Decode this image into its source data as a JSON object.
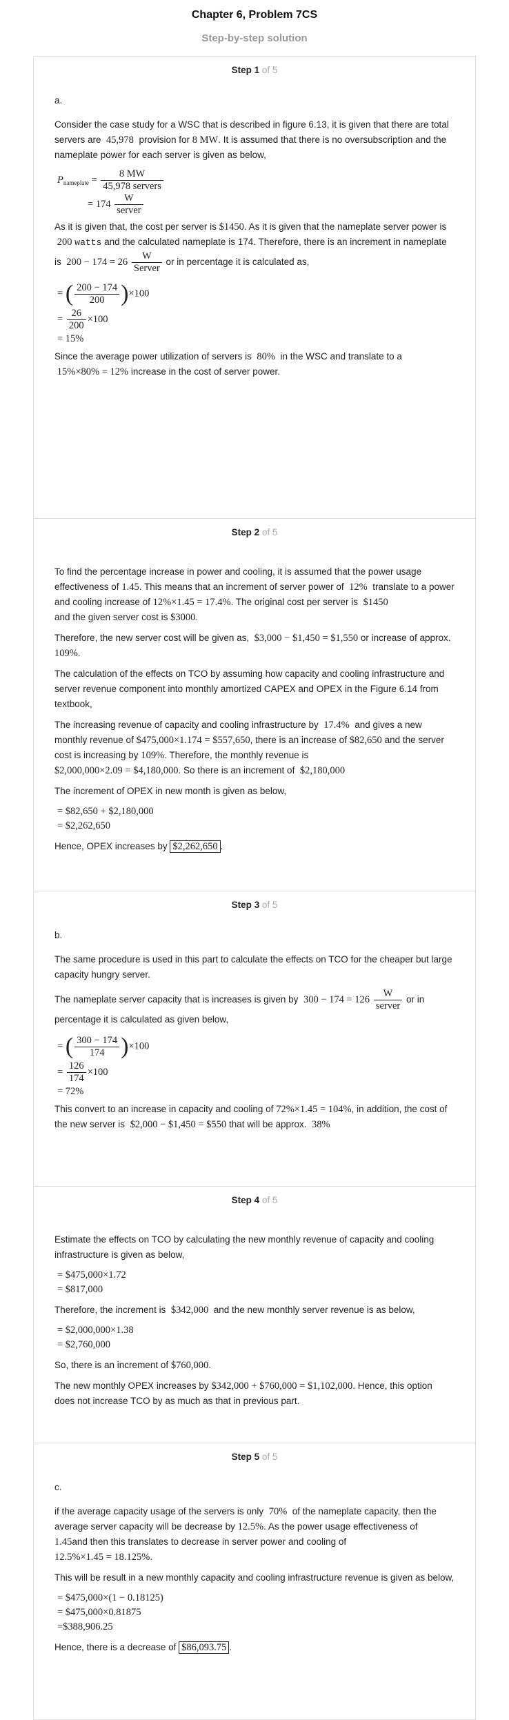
{
  "header": {
    "title": "Chapter 6, Problem 7CS",
    "subtitle": "Step-by-step solution"
  },
  "steps": [
    {
      "label": "Step 1",
      "of": "of 5",
      "part": "a.",
      "p1a": "Consider the case study for a WSC that is described in figure 6.13, it is given that there are total servers are",
      "p1_servers": "45,978",
      "p1b": "provision for",
      "p1_mw": "8 MW",
      "p1c": ". It is assumed that there is no oversubscription and the nameplate power for each server is given as below,",
      "eq1_lhs": "P",
      "eq1_sub": "nameplate",
      "eq1_num": "8 MW",
      "eq1_den": "45,978 servers",
      "eq1_res": "174",
      "eq1_unit_num": "W",
      "eq1_unit_den": "server",
      "p2a": "As it is given that, the cost per server is",
      "p2_cost": "$1450",
      "p2b": ". As it is given that the nameplate server power is",
      "p2_200": "200",
      "p2_watts": "watts",
      "p2c": "and the calculated nameplate is 174. Therefore, there is an increment in nameplate is",
      "p2_expr": "200 − 174 = 26",
      "p2_unit_num": "W",
      "p2_unit_den": "Server",
      "p2d": "or in percentage it is calculated as,",
      "eq2_num": "200 − 174",
      "eq2_den": "200",
      "eq2_tail": "×100",
      "eq2b_num": "26",
      "eq2b_den": "200",
      "eq2b_tail": "×100",
      "eq2c": "= 15%",
      "p3a": "Since the average power utilization of servers is",
      "p3_pct": "80%",
      "p3b": "in the WSC and translate to a",
      "p3_expr": "15%×80% = 12%",
      "p3c": "increase in the cost of server power."
    },
    {
      "label": "Step 2",
      "of": "of 5",
      "p1a": "To find the percentage increase in power and cooling, it is assumed that the power usage effectiveness of",
      "p1_pue": "1.45",
      "p1b": ". This means that an increment of server power of",
      "p1_12": "12%",
      "p1c": "translate to a power and cooling increase of",
      "p1_expr": "12%×1.45 = 17.4%",
      "p1d": ". The original cost per server is",
      "p1_1450": "$1450",
      "p1e": "and the given server cost is",
      "p1_3000": "$3000",
      "p1f": ".",
      "p2a": "Therefore, the new server cost will be given as,",
      "p2_expr": "$3,000 − $1,450 = $1,550",
      "p2b": "or increase of approx.",
      "p2_pct": "109%",
      "p2c": ".",
      "p3": "The calculation of the effects on TCO by assuming how capacity and cooling infrastructure and server revenue component into monthly amortized CAPEX and OPEX in the Figure 6.14 from textbook,",
      "p4a": "The increasing revenue of capacity and cooling infrastructure by",
      "p4_pct": "17.4%",
      "p4b": "and gives a new monthly revenue of",
      "p4_expr1": "$475,000×1.174 = $557,650",
      "p4c": ", there is an increase of",
      "p4_inc": "$82,650",
      "p4d": "and the server cost is increasing by",
      "p4_109": "109%",
      "p4e": ". Therefore, the monthly revenue is",
      "p4_expr2": "$2,000,000×2.09 = $4,180,000",
      "p4f": ". So there is an increment of",
      "p4_inc2": "$2,180,000",
      "p5": "The increment of OPEX in new month is given as below,",
      "eq1": "= $82,650 + $2,180,000",
      "eq2": "= $2,262,650",
      "p6a": "Hence, OPEX increases by",
      "p6_box": "$2,262,650",
      "p6b": "."
    },
    {
      "label": "Step 3",
      "of": "of 5",
      "part": "b.",
      "p1": "The same procedure is used in this part to calculate the effects on TCO for the cheaper but large capacity hungry server.",
      "p2a": "The nameplate server capacity that is increases is given by",
      "p2_expr": "300 − 174 = 126",
      "p2_unit_num": "W",
      "p2_unit_den": "server",
      "p2b": "or in percentage it is calculated as given below,",
      "eq1_num": "300 − 174",
      "eq1_den": "174",
      "eq1_tail": "×100",
      "eq2_num": "126",
      "eq2_den": "174",
      "eq2_tail": "×100",
      "eq3": "= 72%",
      "p3a": "This convert to an increase in capacity and cooling of",
      "p3_expr": "72%×1.45 = 104%",
      "p3b": ", in addition, the cost of the new server is",
      "p3_expr2": "$2,000 − $1,450 = $550",
      "p3c": "that will be approx.",
      "p3_pct": "38%"
    },
    {
      "label": "Step 4",
      "of": "of 5",
      "p1": "Estimate the effects on TCO by calculating the new monthly revenue of capacity and cooling infrastructure is given as below,",
      "eq1": "= $475,000×1.72",
      "eq2": "= $817,000",
      "p2a": "Therefore, the increment is",
      "p2_val": "$342,000",
      "p2b": "and the new monthly server revenue is as below,",
      "eq3": "= $2,000,000×1.38",
      "eq4": "= $2,760,000",
      "p3a": "So, there is an increment of",
      "p3_val": "$760,000",
      "p3b": ".",
      "p4a": "The new monthly OPEX increases by",
      "p4_expr": "$342,000 + $760,000 = $1,102,000",
      "p4b": ". Hence, this option does not increase TCO by as much as that in previous part."
    },
    {
      "label": "Step 5",
      "of": "of 5",
      "part": "c.",
      "p1a": "if the average capacity usage of the servers is only",
      "p1_70": "70%",
      "p1b": "of the nameplate capacity, then the average server capacity will be decrease by",
      "p1_125": "12.5%",
      "p1c": ". As the power usage effectiveness of",
      "p1_pue": "1.45",
      "p1d": "and then this translates to decrease in server power and cooling of",
      "p1_expr": "12.5%×1.45 = 18.125%",
      "p1e": ".",
      "p2": "This will be result in a new monthly capacity and cooling infrastructure revenue is given as below,",
      "eq1": "= $475,000×(1 − 0.18125)",
      "eq2": "= $475,000×0.81875",
      "eq3": "=$388,906.25",
      "p3a": "Hence, there is a decrease of",
      "p3_box": "$86,093.75",
      "p3b": "."
    }
  ]
}
